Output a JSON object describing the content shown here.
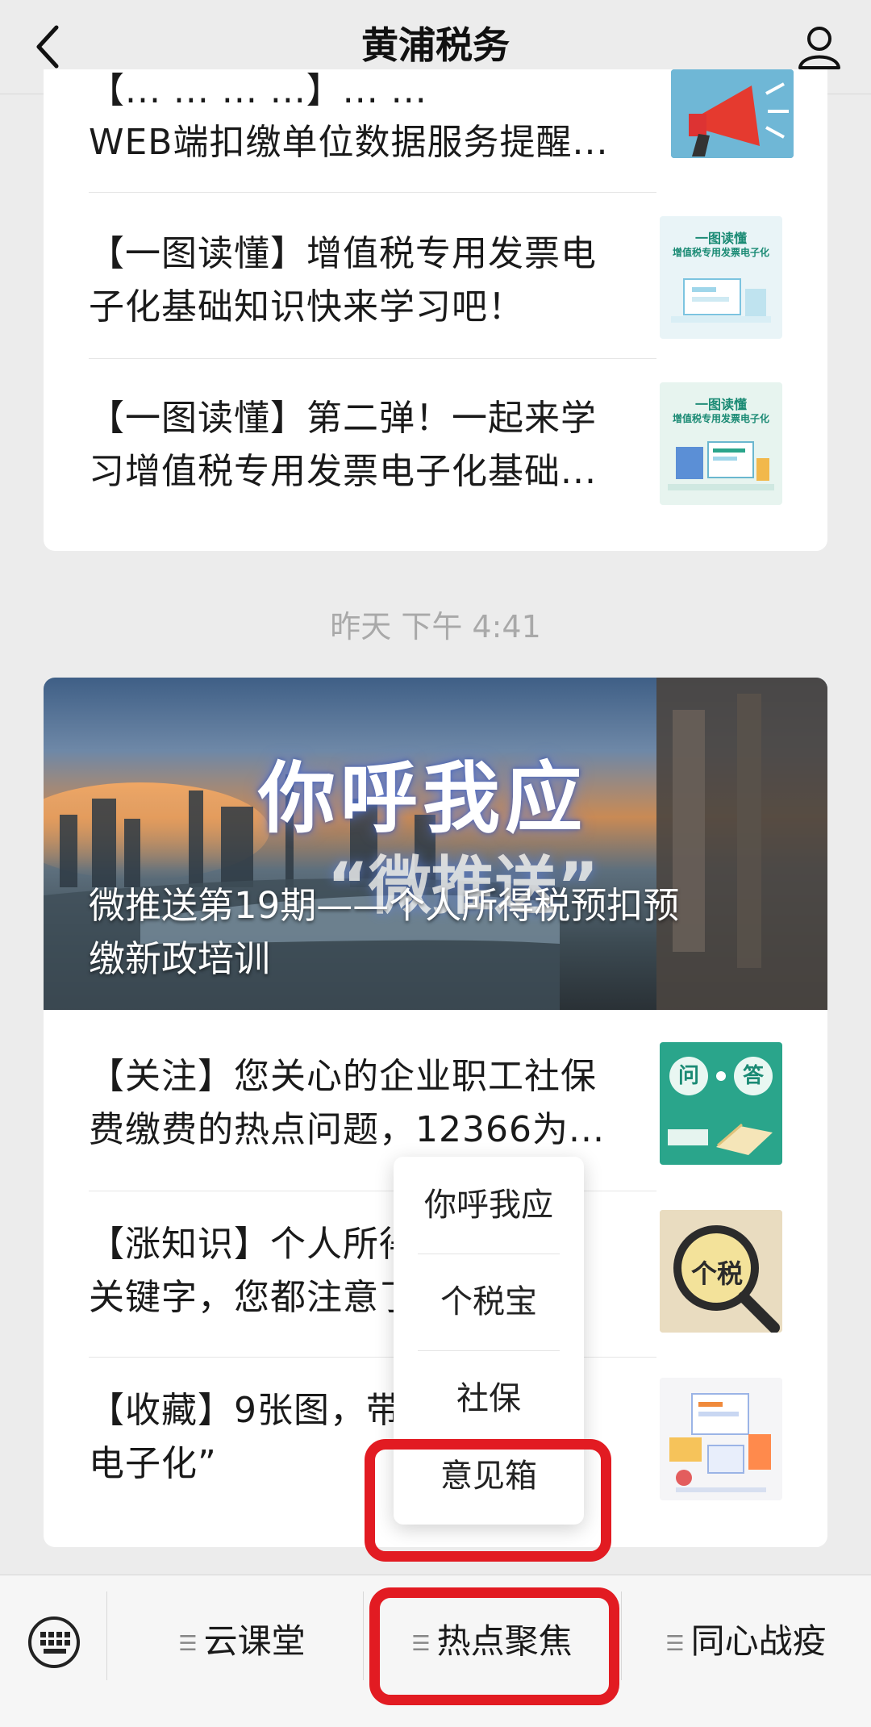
{
  "header": {
    "title": "黄浦税务"
  },
  "card1": {
    "items": [
      {
        "line1": "【... ... ... ...】... ...",
        "line2": "WEB端扣缴单位数据服务提醒..."
      },
      {
        "line1": "【一图读懂】增值税专用发票电",
        "line2": "子化基础知识快来学习吧！"
      },
      {
        "line1": "【一图读懂】第二弹！一起来学",
        "line2": "习增值税专用发票电子化基础..."
      }
    ],
    "thumbs": [
      {
        "icon": "megaphone-icon"
      },
      {
        "title": "一图读懂",
        "subtitle": "增值税专用发票电子化"
      },
      {
        "title": "一图读懂",
        "subtitle": "增值税专用发票电子化"
      }
    ]
  },
  "timestamp": "昨天 下午 4:41",
  "card2": {
    "hero": {
      "headline": "你呼我应",
      "subheadline": "“微推送”",
      "title_line1": "微推送第19期——个人所得税预扣预",
      "title_line2": "缴新政培训"
    },
    "items": [
      {
        "line1": "【关注】您关心的企业职工社保",
        "line2": "费缴费的热点问题，12366为..."
      },
      {
        "line1": "【涨知识】个人所得税...关",
        "line2": "关键字，您都注意了..."
      },
      {
        "line1": "【收藏】9张图，带...票",
        "line2": "电子化”"
      }
    ],
    "thumbs": [
      {
        "left": "问",
        "right": "答"
      },
      {
        "label": "个税"
      },
      {
        "icon": "infographic-icon"
      }
    ]
  },
  "popup": {
    "items": [
      "你呼我应",
      "个税宝",
      "社保",
      "意见箱"
    ]
  },
  "bottom": {
    "tabs": [
      "云课堂",
      "热点聚焦",
      "同心战疫"
    ]
  },
  "colors": {
    "highlight": "#e21b22",
    "accent": "#2aa58b"
  }
}
